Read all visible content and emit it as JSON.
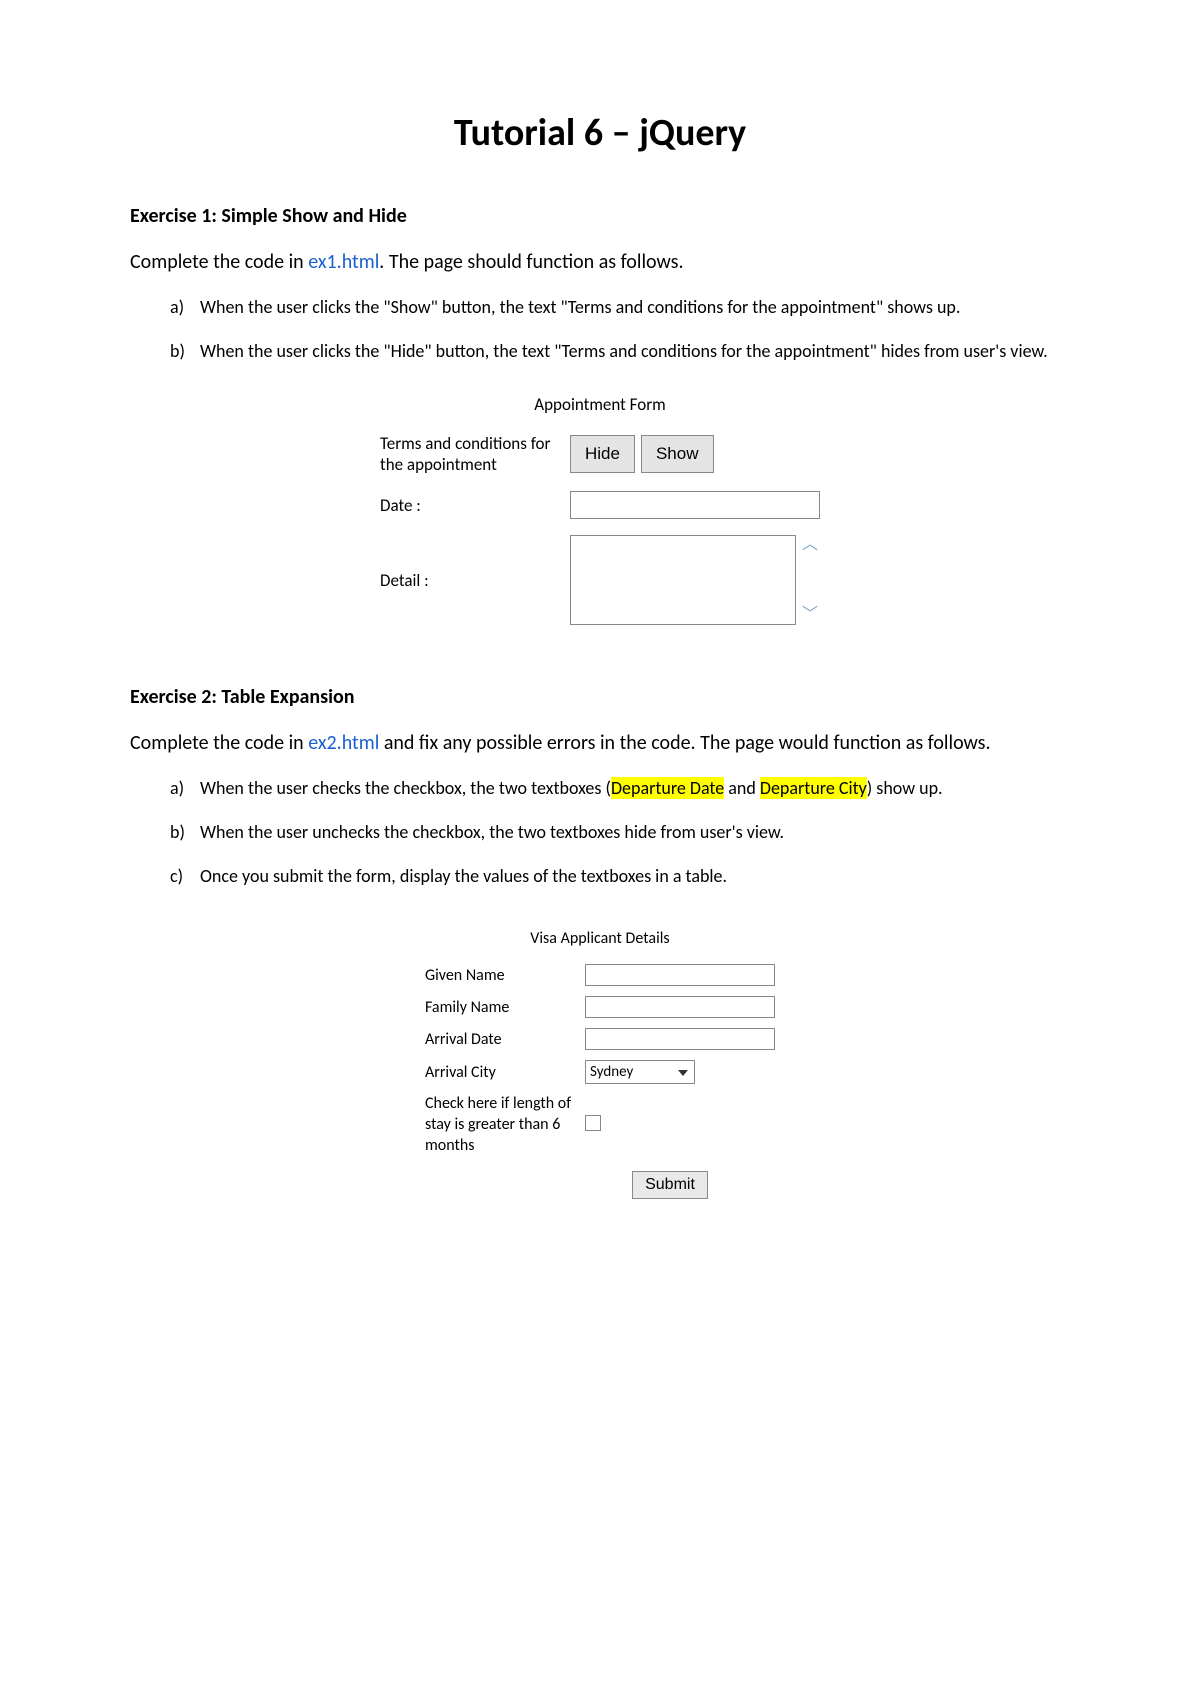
{
  "title": "Tutorial 6 – jQuery",
  "exercise1": {
    "heading": "Exercise 1: Simple Show and Hide",
    "intro_before": "Complete the code in ",
    "intro_link": "ex1.html",
    "intro_after": ". The page should function as follows.",
    "items": [
      {
        "marker": "a)",
        "text": "When the user clicks the \"Show\" button, the text \"Terms and conditions for the appointment\" shows up."
      },
      {
        "marker": "b)",
        "text": "When the user clicks the \"Hide\" button, the text \"Terms and conditions for the appointment\" hides from user's view."
      }
    ],
    "form": {
      "title": "Appointment Form",
      "terms_label": "Terms and conditions for the appointment",
      "hide_btn": "Hide",
      "show_btn": "Show",
      "date_label": "Date  :",
      "detail_label": "Detail  :"
    }
  },
  "exercise2": {
    "heading": "Exercise 2: Table Expansion",
    "intro_before": "Complete the code in ",
    "intro_link": "ex2.html",
    "intro_after": " and fix any possible errors in the code. The page would function as follows.",
    "items": [
      {
        "marker": "a)",
        "before": "When the user checks the checkbox, the two textboxes (",
        "hl1": "Departure Date",
        "mid": " and ",
        "hl2": "Departure City",
        "after": ") show up."
      },
      {
        "marker": "b)",
        "text": "When the user unchecks the checkbox, the two textboxes hide from user's view."
      },
      {
        "marker": "c)",
        "text": "Once you submit the form, display the values of the textboxes in a table."
      }
    ],
    "form": {
      "title": "Visa Applicant Details",
      "given_name": "Given Name",
      "family_name": "Family Name",
      "arrival_date": "Arrival Date",
      "arrival_city": "Arrival City",
      "arrival_city_value": "Sydney",
      "checkbox_label": "Check here if length of stay is greater than 6 months",
      "submit": "Submit"
    }
  }
}
